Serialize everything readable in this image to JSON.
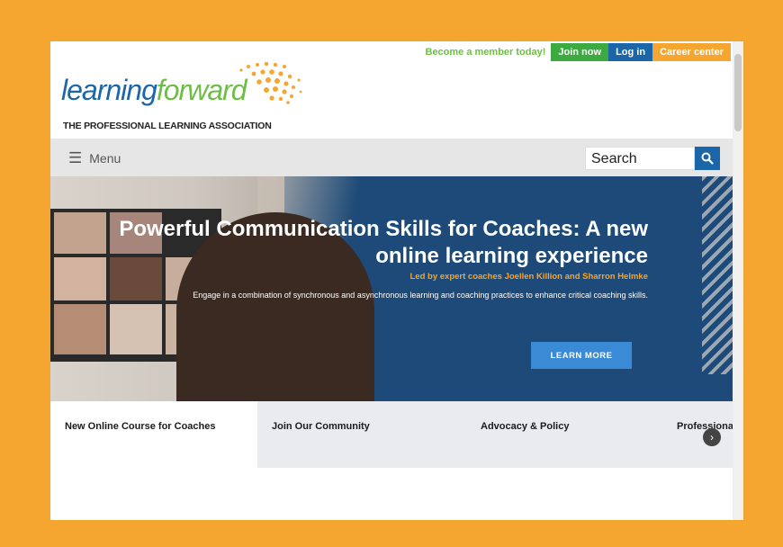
{
  "top_links": {
    "become": "Become a member today!",
    "join": "Join now",
    "login": "Log in",
    "career": "Career center"
  },
  "logo": {
    "word_a": "learning",
    "word_b": "forward",
    "tagline": "THE PROFESSIONAL LEARNING ASSOCIATION"
  },
  "nav": {
    "menu_label": "Menu",
    "search_placeholder": "Search"
  },
  "hero": {
    "title": "Powerful Communication Skills for Coaches: A new online learning experience",
    "subtitle": "Led by expert coaches Joellen Killion and Sharron Helmke",
    "body": "Engage in a combination of synchronous and asynchronous learning and coaching practices to enhance critical coaching skills.",
    "cta": "LEARN MORE"
  },
  "tabs": [
    {
      "label": "New Online Course for Coaches"
    },
    {
      "label": "Join Our Community"
    },
    {
      "label": "Advocacy & Policy"
    },
    {
      "label": "Professional Learning"
    }
  ],
  "colors": {
    "frame": "#f5a631",
    "brand_blue": "#1b66a8",
    "brand_green": "#6dbe45",
    "hero_bg": "#1d4a78"
  }
}
